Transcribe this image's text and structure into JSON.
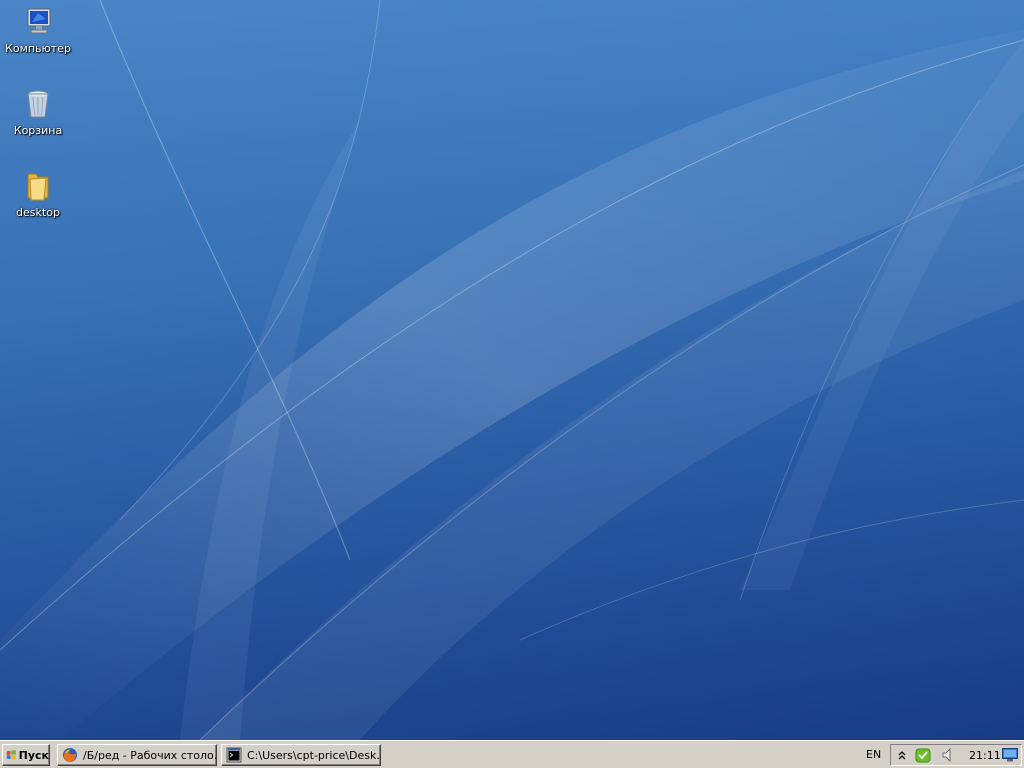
{
  "desktop": {
    "icons": [
      {
        "label": "Компьютер",
        "icon": "computer-icon"
      },
      {
        "label": "Корзина",
        "icon": "recycle-bin-icon"
      },
      {
        "label": "desktop",
        "icon": "folder-icon"
      }
    ]
  },
  "taskbar": {
    "start_label": "Пуск",
    "tasks": [
      {
        "label": "/Б/ред - Рабочих столо...",
        "icon": "firefox-icon"
      },
      {
        "label": "C:\\Users\\cpt-price\\Desk...",
        "icon": "cmd-icon"
      }
    ],
    "language": "EN",
    "tray": {
      "icons": [
        "chevron-up-icon",
        "shield-icon",
        "volume-icon",
        "network-icon"
      ],
      "clock": "21:11"
    }
  },
  "colors": {
    "wallpaper_top": "#4a86c8",
    "wallpaper_bottom": "#1f4592",
    "taskbar": "#d4d0c8"
  }
}
